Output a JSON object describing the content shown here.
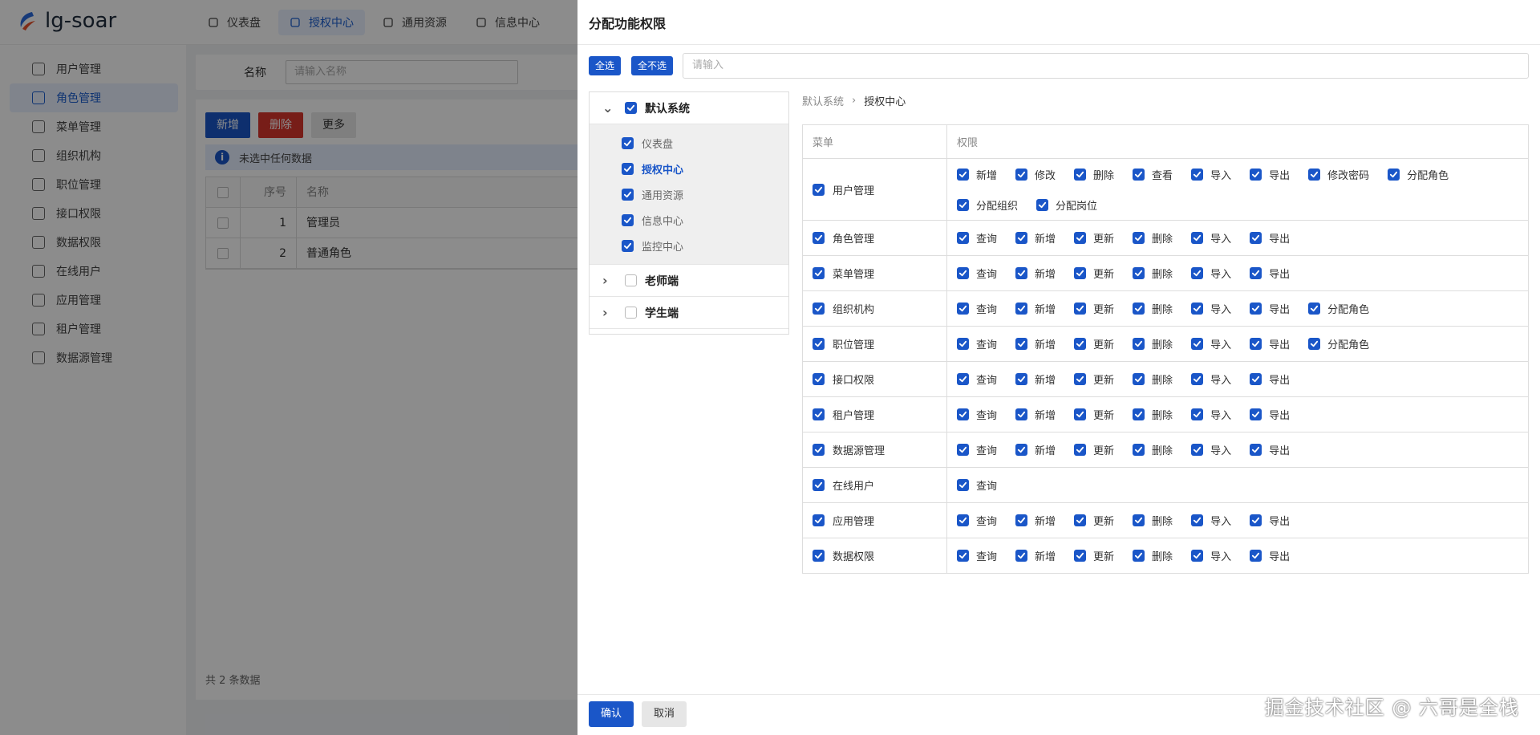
{
  "app": {
    "name": "lg-soar",
    "brand_color": "#1a56c8",
    "topnav": [
      {
        "label": "仪表盘",
        "icon": "dashboard-icon"
      },
      {
        "label": "授权中心",
        "icon": "lock-icon",
        "active": true
      },
      {
        "label": "通用资源",
        "icon": "globe-icon"
      },
      {
        "label": "信息中心",
        "icon": "flag-icon"
      }
    ],
    "sidebar": [
      {
        "label": "用户管理",
        "icon": "user-icon"
      },
      {
        "label": "角色管理",
        "icon": "users-icon",
        "active": true
      },
      {
        "label": "菜单管理",
        "icon": "menu-icon"
      },
      {
        "label": "组织机构",
        "icon": "org-icon"
      },
      {
        "label": "职位管理",
        "icon": "layers-icon"
      },
      {
        "label": "接口权限",
        "icon": "api-icon"
      },
      {
        "label": "数据权限",
        "icon": "data-icon"
      },
      {
        "label": "在线用户",
        "icon": "online-user-icon"
      },
      {
        "label": "应用管理",
        "icon": "app-icon"
      },
      {
        "label": "租户管理",
        "icon": "tenant-icon"
      },
      {
        "label": "数据源管理",
        "icon": "datasource-icon"
      }
    ]
  },
  "role_page": {
    "search_label": "名称",
    "search_placeholder": "请输入名称",
    "btn_add": "新增",
    "btn_delete": "删除",
    "btn_more": "更多",
    "info_text": "未选中任何数据",
    "columns": [
      "序号",
      "名称"
    ],
    "rows": [
      {
        "no": "1",
        "name": "管理员"
      },
      {
        "no": "2",
        "name": "普通角色"
      }
    ],
    "total": "共 2 条数据"
  },
  "drawer": {
    "title": "分配功能权限",
    "select_all": "全选",
    "select_none": "全不选",
    "filter_placeholder": "请输入",
    "tree": {
      "root": {
        "label": "默认系统",
        "checked": true,
        "expanded": true
      },
      "children": [
        {
          "label": "仪表盘",
          "checked": true
        },
        {
          "label": "授权中心",
          "checked": true,
          "active": true
        },
        {
          "label": "通用资源",
          "checked": true
        },
        {
          "label": "信息中心",
          "checked": true
        },
        {
          "label": "监控中心",
          "checked": true
        }
      ],
      "others": [
        {
          "label": "老师端",
          "checked": false
        },
        {
          "label": "学生端",
          "checked": false
        }
      ]
    },
    "breadcrumb": [
      "默认系统",
      "授权中心"
    ],
    "table_headers": {
      "menu": "菜单",
      "perm": "权限"
    },
    "permissions": [
      {
        "menu": "用户管理",
        "perms": [
          "新增",
          "修改",
          "删除",
          "查看",
          "导入",
          "导出",
          "修改密码",
          "分配角色",
          "分配组织",
          "分配岗位"
        ]
      },
      {
        "menu": "角色管理",
        "perms": [
          "查询",
          "新增",
          "更新",
          "删除",
          "导入",
          "导出"
        ]
      },
      {
        "menu": "菜单管理",
        "perms": [
          "查询",
          "新增",
          "更新",
          "删除",
          "导入",
          "导出"
        ]
      },
      {
        "menu": "组织机构",
        "perms": [
          "查询",
          "新增",
          "更新",
          "删除",
          "导入",
          "导出",
          "分配角色"
        ]
      },
      {
        "menu": "职位管理",
        "perms": [
          "查询",
          "新增",
          "更新",
          "删除",
          "导入",
          "导出",
          "分配角色"
        ]
      },
      {
        "menu": "接口权限",
        "perms": [
          "查询",
          "新增",
          "更新",
          "删除",
          "导入",
          "导出"
        ]
      },
      {
        "menu": "租户管理",
        "perms": [
          "查询",
          "新增",
          "更新",
          "删除",
          "导入",
          "导出"
        ]
      },
      {
        "menu": "数据源管理",
        "perms": [
          "查询",
          "新增",
          "更新",
          "删除",
          "导入",
          "导出"
        ]
      },
      {
        "menu": "在线用户",
        "perms": [
          "查询"
        ]
      },
      {
        "menu": "应用管理",
        "perms": [
          "查询",
          "新增",
          "更新",
          "删除",
          "导入",
          "导出"
        ]
      },
      {
        "menu": "数据权限",
        "perms": [
          "查询",
          "新增",
          "更新",
          "删除",
          "导入",
          "导出"
        ]
      }
    ],
    "btn_ok": "确认",
    "btn_cancel": "取消",
    "watermark": "掘金技术社区 @ 六哥是全栈"
  }
}
